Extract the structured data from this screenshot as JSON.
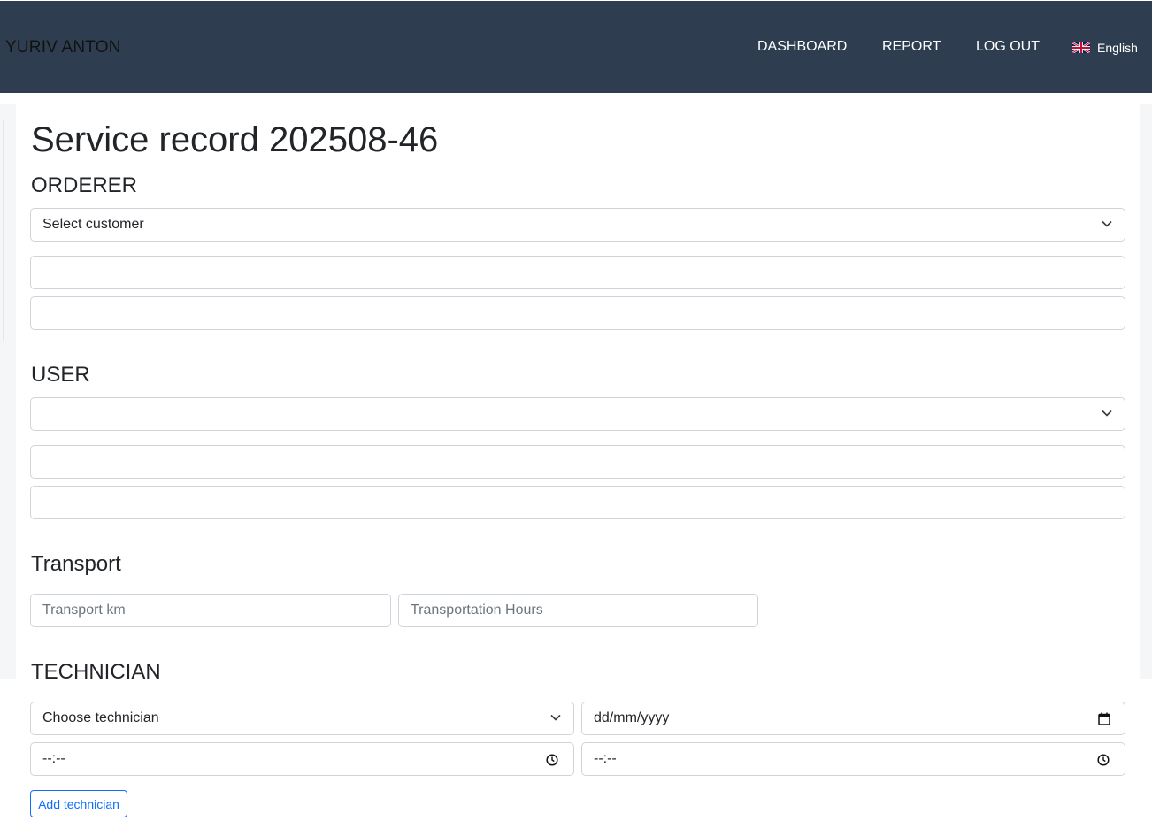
{
  "header": {
    "brand": "YURIV ANTON",
    "nav": [
      "DASHBOARD",
      "REPORT",
      "LOG OUT"
    ],
    "language": "English",
    "bg_color": "#2e3e50"
  },
  "page": {
    "title": "Service record 202508-46"
  },
  "orderer": {
    "heading": "ORDERER",
    "customer_select": "Select customer",
    "field1": "",
    "field2": ""
  },
  "user": {
    "heading": "USER",
    "select": "",
    "field1": "",
    "field2": ""
  },
  "transport": {
    "heading": "Transport",
    "km_placeholder": "Transport km",
    "hours_placeholder": "Transportation Hours"
  },
  "technician": {
    "heading": "TECHNICIAN",
    "select": "Choose technician",
    "date": "dd/mm/yyyy",
    "time_from": "--:--",
    "time_to": "--:--",
    "add_button": "Add technician"
  },
  "icons": {
    "select": "chevron-down-icon",
    "date": "calendar-icon",
    "time": "clock-icon",
    "language": "uk-flag-icon"
  },
  "accent_color": "#0d6efd"
}
